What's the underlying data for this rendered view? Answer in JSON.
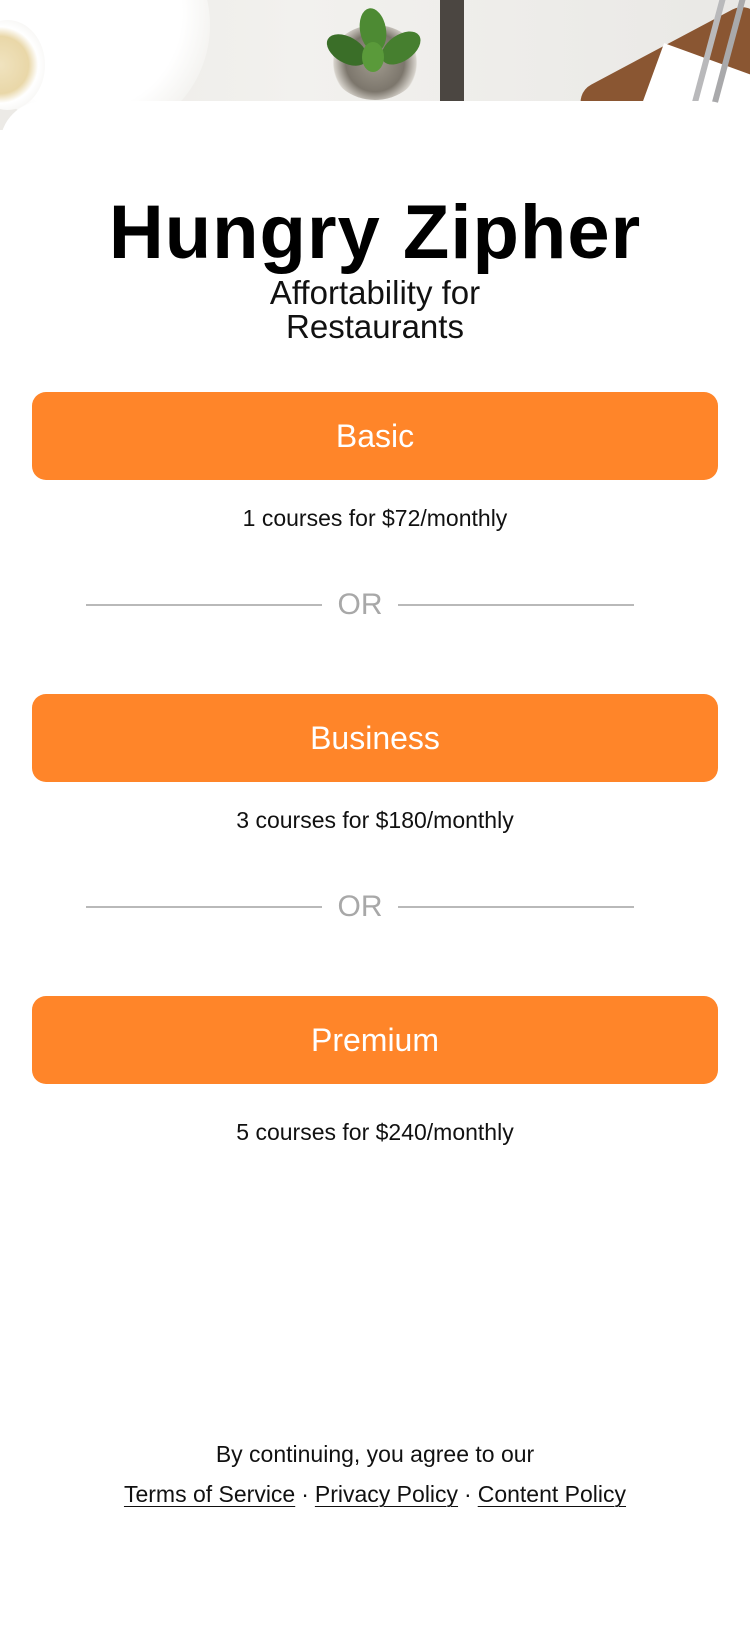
{
  "app": {
    "title": "Hungry Zipher",
    "subtitle": "Affortability for Restaurants"
  },
  "plans": [
    {
      "label": "Basic",
      "description": "1 courses for $72/monthly"
    },
    {
      "label": "Business",
      "description": "3 courses for $180/monthly"
    },
    {
      "label": "Premium",
      "description": "5 courses for $240/monthly"
    }
  ],
  "divider_text": "OR",
  "footer": {
    "agree_text": "By continuing, you agree to our",
    "links": [
      "Terms of Service",
      "Privacy Policy",
      "Content Policy"
    ],
    "separator": "·"
  },
  "colors": {
    "accent": "#ff8529",
    "divider": "#b9b9b9",
    "or_text": "#a8a8a8"
  },
  "hero_image": "table-top-photo"
}
